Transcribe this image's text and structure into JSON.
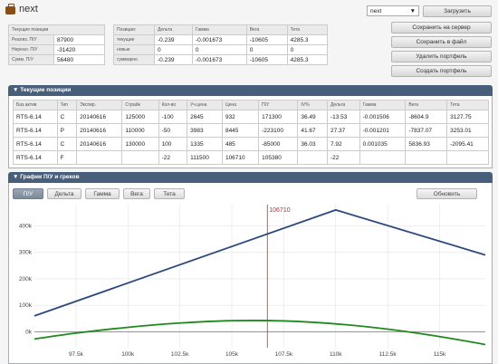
{
  "header": {
    "title": "next"
  },
  "portfolio_select": {
    "value": "next",
    "arrow": "▼"
  },
  "buttons": {
    "load": "Загрузить",
    "save_server": "Сохранить на сервер",
    "save_file": "Сохранить в файл",
    "delete": "Удалить портфель",
    "create": "Создать портфель"
  },
  "pnl_table": {
    "header": "Текущие позиции",
    "rows": [
      {
        "label": "Реализ. П/У",
        "value": "87900"
      },
      {
        "label": "Нереал. П/У",
        "value": "-31420"
      },
      {
        "label": "Сумм. П/У",
        "value": "56480"
      }
    ]
  },
  "greeks_table": {
    "headers": [
      "Позиции:",
      "Дельта",
      "Гамма",
      "Вега",
      "Тета"
    ],
    "rows": [
      [
        "текущие",
        "-0.239",
        "-0.001673",
        "-10605",
        "4285.3"
      ],
      [
        "новые",
        "0",
        "0",
        "0",
        "0"
      ],
      [
        "суммарно",
        "-0.239",
        "-0.001673",
        "-10605",
        "4285.3"
      ]
    ]
  },
  "positions_panel": {
    "title": "▼ Текущие позиции",
    "headers": [
      "Баз.актив",
      "Тип",
      "Экспир.",
      "Страйк",
      "Кол-во",
      "Уч.цена",
      "Цена",
      "П/У",
      "IV%",
      "Дельта",
      "Гамма",
      "Вега",
      "Тета"
    ],
    "rows": [
      [
        "RTS-6.14",
        "C",
        "20140616",
        "125000",
        "-100",
        "2645",
        "932",
        "171300",
        "36.49",
        "-13.53",
        "-0.001506",
        "-8604.9",
        "3127.75"
      ],
      [
        "RTS-6.14",
        "P",
        "20140616",
        "110000",
        "-50",
        "3983",
        "8445",
        "-223100",
        "41.67",
        "27.37",
        "-0.001201",
        "-7837.07",
        "3253.01"
      ],
      [
        "RTS-6.14",
        "C",
        "20140616",
        "130000",
        "100",
        "1335",
        "485",
        "-85000",
        "36.03",
        "7.92",
        "0.001035",
        "5836.93",
        "-2095.41"
      ],
      [
        "RTS-6.14",
        "F",
        "",
        "",
        "-22",
        "111500",
        "106710",
        "105380",
        "",
        "-22",
        "",
        "",
        ""
      ]
    ]
  },
  "chart_panel": {
    "title": "▼ График П/У и греков",
    "tabs": [
      "П/У",
      "Дельта",
      "Гамма",
      "Вега",
      "Тета"
    ],
    "active_tab": "П/У",
    "refresh": "Обновить"
  },
  "chart_data": {
    "type": "line",
    "x_ticks": [
      "97.5k",
      "100k",
      "102.5k",
      "105k",
      "107.5k",
      "110k",
      "112.5k",
      "115k"
    ],
    "y_ticks": [
      "0k",
      "100k",
      "200k",
      "300k",
      "400k"
    ],
    "xlim": [
      95500,
      117200
    ],
    "ylim": [
      -60000,
      480000
    ],
    "current_price": 106710,
    "current_price_label": "106710",
    "series": [
      {
        "color": "#2c4a7c",
        "x": [
          95500,
          110000,
          117200
        ],
        "y": [
          60000,
          460000,
          290000
        ]
      },
      {
        "color": "#1e8a1e",
        "x": [
          95500,
          97500,
          100000,
          102500,
          105000,
          107500,
          110000,
          112500,
          115000,
          117200
        ],
        "y": [
          -27000,
          -5000,
          17000,
          33000,
          42000,
          41000,
          30000,
          10000,
          -18000,
          -48000
        ]
      }
    ],
    "colors": {
      "zero_line": "#888888",
      "price_line": "#b83232",
      "grid": "#e3e3e3"
    }
  }
}
